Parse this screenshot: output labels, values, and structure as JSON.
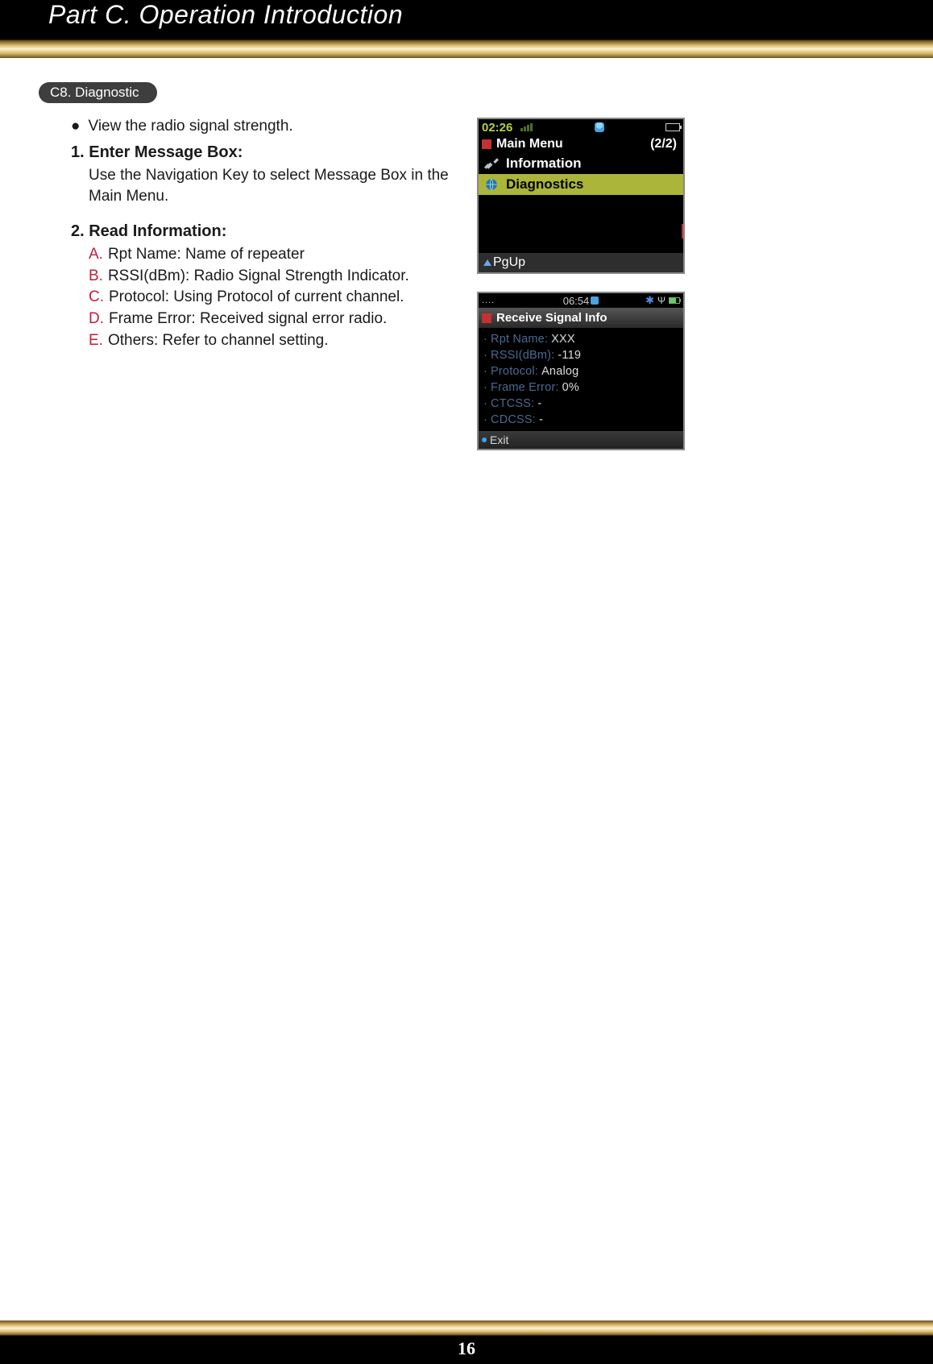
{
  "header": {
    "title": "Part C. Operation Introduction"
  },
  "section": {
    "label": "C8. Diagnostic"
  },
  "intro_bullet": "View the radio signal strength.",
  "steps": [
    {
      "title": "1. Enter Message Box:",
      "body": "Use the Navigation Key to select Message Box in the Main Menu."
    },
    {
      "title": "2. Read Information:",
      "items": [
        {
          "letter": "A.",
          "text": "Rpt Name: Name of repeater"
        },
        {
          "letter": "B.",
          "text": "RSSI(dBm): Radio Signal Strength Indicator."
        },
        {
          "letter": "C.",
          "text": "Protocol: Using Protocol of current channel."
        },
        {
          "letter": "D.",
          "text": "Frame Error: Received signal error radio."
        },
        {
          "letter": "E.",
          "text": "Others: Refer to channel setting."
        }
      ]
    }
  ],
  "screen1": {
    "time": "02:26",
    "title": "Main Menu",
    "page": "(2/2)",
    "rows": [
      {
        "label": "Information",
        "icon": "tools-icon",
        "selected": false
      },
      {
        "label": "Diagnostics",
        "icon": "globe-icon",
        "selected": true
      }
    ],
    "footer": "PgUp"
  },
  "screen2": {
    "dots": "....",
    "time": "06:54",
    "title": "Receive Signal Info",
    "lines": [
      {
        "key": "Rpt Name:",
        "val": "XXX"
      },
      {
        "key": "RSSI(dBm):",
        "val": "-119"
      },
      {
        "key": "Protocol:",
        "val": "Analog"
      },
      {
        "key": "Frame Error:",
        "val": "0%"
      },
      {
        "key": "CTCSS:",
        "val": "-"
      },
      {
        "key": "CDCSS:",
        "val": "-"
      }
    ],
    "footer": "Exit"
  },
  "page_number": "16"
}
